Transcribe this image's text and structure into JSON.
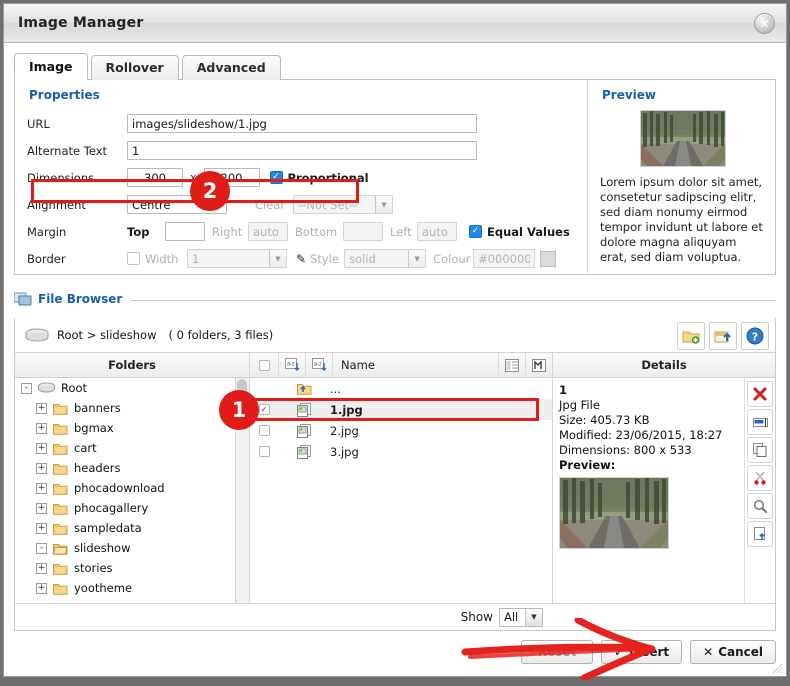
{
  "window": {
    "title": "Image Manager",
    "close_icon": "close-icon"
  },
  "tabs": [
    {
      "label": "Image",
      "active": true
    },
    {
      "label": "Rollover",
      "active": false
    },
    {
      "label": "Advanced",
      "active": false
    }
  ],
  "properties": {
    "section_title": "Properties",
    "url": {
      "label": "URL",
      "value": "images/slideshow/1.jpg"
    },
    "alt": {
      "label": "Alternate Text",
      "value": "1"
    },
    "dimensions": {
      "label": "Dimensions",
      "width": "300",
      "separator": "x",
      "height": "200",
      "proportional_label": "Proportional",
      "proportional_checked": true
    },
    "alignment": {
      "label": "Alignment",
      "value": "Centre",
      "clear_label": "Clear",
      "clear_value": "--Not Set--"
    },
    "margin": {
      "label": "Margin",
      "top_label": "Top",
      "top_value": "",
      "right_label": "Right",
      "right_value": "auto",
      "bottom_label": "Bottom",
      "bottom_value": "",
      "left_label": "Left",
      "left_value": "auto",
      "equal_label": "Equal Values",
      "equal_checked": true
    },
    "border": {
      "label": "Border",
      "width_label": "Width",
      "width_value": "1",
      "style_label": "Style",
      "style_value": "solid",
      "colour_label": "Colour",
      "colour_value": "#000000",
      "width_checked": false
    }
  },
  "preview": {
    "title": "Preview",
    "body": "Lorem ipsum dolor sit amet, consetetur sadipscing elitr, sed diam nonumy eirmod tempor invidunt ut labore et dolore magna aliquyam erat, sed diam voluptua."
  },
  "file_browser": {
    "legend": "File Browser",
    "legend_icon": "file-browser-icon",
    "breadcrumb": "Root  >  slideshow",
    "counts": "( 0 folders, 3 files)",
    "drive_icon": "drive-icon",
    "toolbar": [
      {
        "name": "new-folder-icon"
      },
      {
        "name": "upload-icon"
      },
      {
        "name": "help-icon"
      }
    ],
    "folders_header": "Folders",
    "name_header": "Name",
    "details_header": "Details",
    "tree": [
      {
        "label": "Root",
        "level": 0,
        "state": "-",
        "icon": "drive-icon"
      },
      {
        "label": "banners",
        "level": 1,
        "state": "+",
        "icon": "folder-icon"
      },
      {
        "label": "bgmax",
        "level": 1,
        "state": "+",
        "icon": "folder-icon"
      },
      {
        "label": "cart",
        "level": 1,
        "state": "+",
        "icon": "folder-icon"
      },
      {
        "label": "headers",
        "level": 1,
        "state": "+",
        "icon": "folder-icon"
      },
      {
        "label": "phocadownload",
        "level": 1,
        "state": "+",
        "icon": "folder-icon"
      },
      {
        "label": "phocagallery",
        "level": 1,
        "state": "+",
        "icon": "folder-icon"
      },
      {
        "label": "sampledata",
        "level": 1,
        "state": "+",
        "icon": "folder-icon"
      },
      {
        "label": "slideshow",
        "level": 1,
        "state": "-",
        "icon": "folder-open-icon"
      },
      {
        "label": "stories",
        "level": 1,
        "state": "+",
        "icon": "folder-icon"
      },
      {
        "label": "yootheme",
        "level": 1,
        "state": "+",
        "icon": "folder-icon"
      }
    ],
    "files": [
      {
        "name": "...",
        "icon": "folder-up-icon",
        "checkbox": false,
        "selected": false,
        "is_parent": true
      },
      {
        "name": "1.jpg",
        "icon": "image-file-icon",
        "checkbox": true,
        "selected": true,
        "is_parent": false
      },
      {
        "name": "2.jpg",
        "icon": "image-file-icon",
        "checkbox": false,
        "selected": false,
        "is_parent": false
      },
      {
        "name": "3.jpg",
        "icon": "image-file-icon",
        "checkbox": false,
        "selected": false,
        "is_parent": false
      }
    ],
    "details": {
      "name": "1",
      "type": "Jpg File",
      "size": "Size: 405.73 KB",
      "modified": "Modified: 23/06/2015, 18:27",
      "dimensions": "Dimensions: 800 x 533",
      "preview_label": "Preview:",
      "actions": [
        {
          "name": "delete-icon"
        },
        {
          "name": "rename-icon"
        },
        {
          "name": "copy-icon"
        },
        {
          "name": "cut-icon"
        },
        {
          "name": "zoom-icon"
        },
        {
          "name": "paste-icon"
        }
      ]
    },
    "show_label": "Show",
    "show_value": "All"
  },
  "dialog_buttons": {
    "hidden_label": "Reset",
    "insert_label": "Insert",
    "insert_icon": "check-icon",
    "cancel_label": "Cancel",
    "cancel_icon": "x-icon"
  },
  "annotations": [
    {
      "number": "1",
      "target": "selected-file-row"
    },
    {
      "number": "2",
      "target": "alignment-row"
    }
  ],
  "colors": {
    "accent_blue": "#1a5fa8",
    "annotation_red": "#e01b18",
    "checkbox_blue": "#2287e8"
  }
}
